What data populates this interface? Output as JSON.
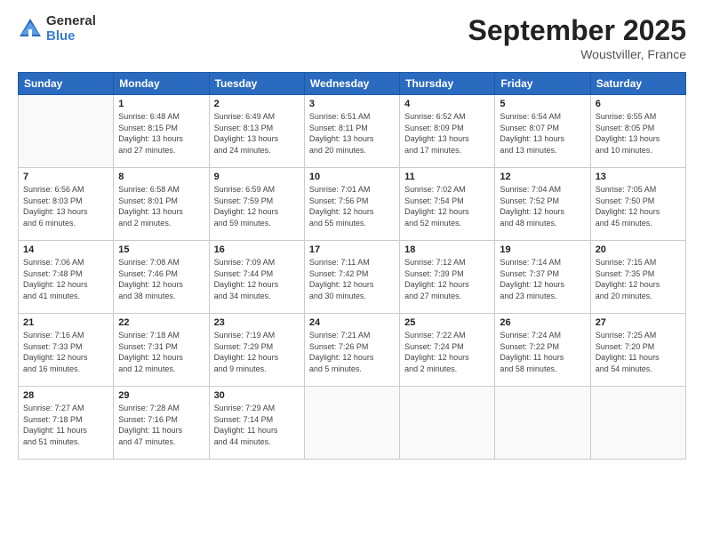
{
  "header": {
    "logo_general": "General",
    "logo_blue": "Blue",
    "month_title": "September 2025",
    "location": "Woustviller, France"
  },
  "weekdays": [
    "Sunday",
    "Monday",
    "Tuesday",
    "Wednesday",
    "Thursday",
    "Friday",
    "Saturday"
  ],
  "weeks": [
    [
      {
        "num": "",
        "info": ""
      },
      {
        "num": "1",
        "info": "Sunrise: 6:48 AM\nSunset: 8:15 PM\nDaylight: 13 hours\nand 27 minutes."
      },
      {
        "num": "2",
        "info": "Sunrise: 6:49 AM\nSunset: 8:13 PM\nDaylight: 13 hours\nand 24 minutes."
      },
      {
        "num": "3",
        "info": "Sunrise: 6:51 AM\nSunset: 8:11 PM\nDaylight: 13 hours\nand 20 minutes."
      },
      {
        "num": "4",
        "info": "Sunrise: 6:52 AM\nSunset: 8:09 PM\nDaylight: 13 hours\nand 17 minutes."
      },
      {
        "num": "5",
        "info": "Sunrise: 6:54 AM\nSunset: 8:07 PM\nDaylight: 13 hours\nand 13 minutes."
      },
      {
        "num": "6",
        "info": "Sunrise: 6:55 AM\nSunset: 8:05 PM\nDaylight: 13 hours\nand 10 minutes."
      }
    ],
    [
      {
        "num": "7",
        "info": "Sunrise: 6:56 AM\nSunset: 8:03 PM\nDaylight: 13 hours\nand 6 minutes."
      },
      {
        "num": "8",
        "info": "Sunrise: 6:58 AM\nSunset: 8:01 PM\nDaylight: 13 hours\nand 2 minutes."
      },
      {
        "num": "9",
        "info": "Sunrise: 6:59 AM\nSunset: 7:59 PM\nDaylight: 12 hours\nand 59 minutes."
      },
      {
        "num": "10",
        "info": "Sunrise: 7:01 AM\nSunset: 7:56 PM\nDaylight: 12 hours\nand 55 minutes."
      },
      {
        "num": "11",
        "info": "Sunrise: 7:02 AM\nSunset: 7:54 PM\nDaylight: 12 hours\nand 52 minutes."
      },
      {
        "num": "12",
        "info": "Sunrise: 7:04 AM\nSunset: 7:52 PM\nDaylight: 12 hours\nand 48 minutes."
      },
      {
        "num": "13",
        "info": "Sunrise: 7:05 AM\nSunset: 7:50 PM\nDaylight: 12 hours\nand 45 minutes."
      }
    ],
    [
      {
        "num": "14",
        "info": "Sunrise: 7:06 AM\nSunset: 7:48 PM\nDaylight: 12 hours\nand 41 minutes."
      },
      {
        "num": "15",
        "info": "Sunrise: 7:08 AM\nSunset: 7:46 PM\nDaylight: 12 hours\nand 38 minutes."
      },
      {
        "num": "16",
        "info": "Sunrise: 7:09 AM\nSunset: 7:44 PM\nDaylight: 12 hours\nand 34 minutes."
      },
      {
        "num": "17",
        "info": "Sunrise: 7:11 AM\nSunset: 7:42 PM\nDaylight: 12 hours\nand 30 minutes."
      },
      {
        "num": "18",
        "info": "Sunrise: 7:12 AM\nSunset: 7:39 PM\nDaylight: 12 hours\nand 27 minutes."
      },
      {
        "num": "19",
        "info": "Sunrise: 7:14 AM\nSunset: 7:37 PM\nDaylight: 12 hours\nand 23 minutes."
      },
      {
        "num": "20",
        "info": "Sunrise: 7:15 AM\nSunset: 7:35 PM\nDaylight: 12 hours\nand 20 minutes."
      }
    ],
    [
      {
        "num": "21",
        "info": "Sunrise: 7:16 AM\nSunset: 7:33 PM\nDaylight: 12 hours\nand 16 minutes."
      },
      {
        "num": "22",
        "info": "Sunrise: 7:18 AM\nSunset: 7:31 PM\nDaylight: 12 hours\nand 12 minutes."
      },
      {
        "num": "23",
        "info": "Sunrise: 7:19 AM\nSunset: 7:29 PM\nDaylight: 12 hours\nand 9 minutes."
      },
      {
        "num": "24",
        "info": "Sunrise: 7:21 AM\nSunset: 7:26 PM\nDaylight: 12 hours\nand 5 minutes."
      },
      {
        "num": "25",
        "info": "Sunrise: 7:22 AM\nSunset: 7:24 PM\nDaylight: 12 hours\nand 2 minutes."
      },
      {
        "num": "26",
        "info": "Sunrise: 7:24 AM\nSunset: 7:22 PM\nDaylight: 11 hours\nand 58 minutes."
      },
      {
        "num": "27",
        "info": "Sunrise: 7:25 AM\nSunset: 7:20 PM\nDaylight: 11 hours\nand 54 minutes."
      }
    ],
    [
      {
        "num": "28",
        "info": "Sunrise: 7:27 AM\nSunset: 7:18 PM\nDaylight: 11 hours\nand 51 minutes."
      },
      {
        "num": "29",
        "info": "Sunrise: 7:28 AM\nSunset: 7:16 PM\nDaylight: 11 hours\nand 47 minutes."
      },
      {
        "num": "30",
        "info": "Sunrise: 7:29 AM\nSunset: 7:14 PM\nDaylight: 11 hours\nand 44 minutes."
      },
      {
        "num": "",
        "info": ""
      },
      {
        "num": "",
        "info": ""
      },
      {
        "num": "",
        "info": ""
      },
      {
        "num": "",
        "info": ""
      }
    ]
  ]
}
